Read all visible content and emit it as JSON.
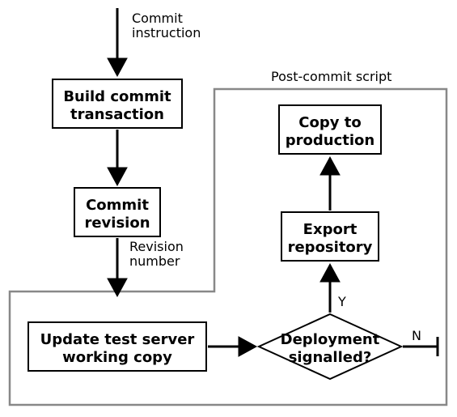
{
  "group": {
    "title": "Post-commit script"
  },
  "nodes": {
    "build": {
      "line1": "Build commit",
      "line2": "transaction"
    },
    "commit": {
      "line1": "Commit",
      "line2": "revision"
    },
    "update": {
      "line1": "Update test server",
      "line2": "working copy"
    },
    "decide": {
      "line1": "Deployment",
      "line2": "signalled?"
    },
    "export": {
      "line1": "Export",
      "line2": "repository"
    },
    "copy": {
      "line1": "Copy to",
      "line2": "production"
    }
  },
  "edges": {
    "in": {
      "line1": "Commit",
      "line2": "instruction"
    },
    "revision": {
      "line1": "Revision",
      "line2": "number"
    },
    "yes": "Y",
    "no": "N"
  }
}
